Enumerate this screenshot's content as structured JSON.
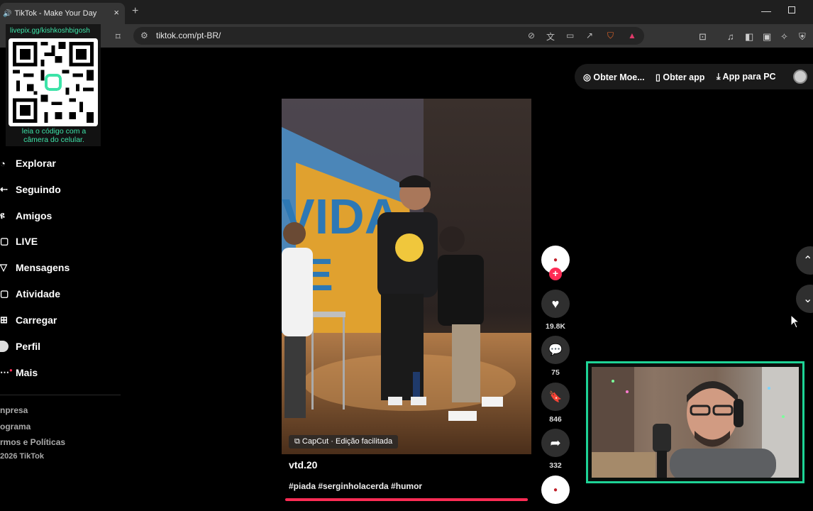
{
  "browser": {
    "tab_title": "TikTok - Make Your Day",
    "tab_close": "×",
    "new_tab": "+",
    "url": "tiktok.com/pt-BR/"
  },
  "qr_overlay": {
    "handle": "livepix.gg/kishkoshbigosh",
    "caption": "leia o código com a câmera do celular."
  },
  "sidebar": {
    "items": [
      {
        "label": "Explorar",
        "icon": "compass-icon"
      },
      {
        "label": "Seguindo",
        "icon": "following-icon"
      },
      {
        "label": "Amigos",
        "icon": "friends-icon"
      },
      {
        "label": "LIVE",
        "icon": "live-icon"
      },
      {
        "label": "Mensagens",
        "icon": "messages-icon"
      },
      {
        "label": "Atividade",
        "icon": "activity-icon"
      },
      {
        "label": "Carregar",
        "icon": "upload-icon"
      },
      {
        "label": "Perfil",
        "icon": "profile-icon"
      },
      {
        "label": "Mais",
        "icon": "more-icon"
      }
    ],
    "footer": [
      "npresa",
      "ograma",
      "rmos e Políticas",
      "2026 TikTok"
    ]
  },
  "header": {
    "coins": "Obter Moe...",
    "get_app": "Obter app",
    "pc_app": "App para PC"
  },
  "video": {
    "author": "vtd.20",
    "hashtags": "#piada #serginholacerda #humor",
    "capcut_label": "CapCut · Edição facilitada",
    "progress": 1.0
  },
  "actions": {
    "likes": "19.8K",
    "comments": "75",
    "saves": "846",
    "shares": "332"
  },
  "colors": {
    "accent": "#fe2c55",
    "qr_green": "#3de3a8",
    "webcam_border": "#1ed396"
  }
}
